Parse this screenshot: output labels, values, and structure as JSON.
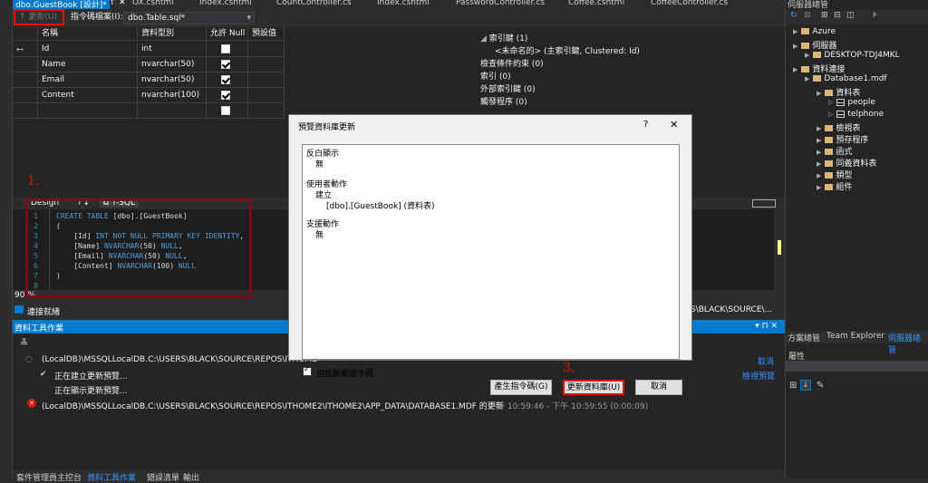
{
  "tabs": [
    "dbo.GuestBook [設計]*",
    "OX.cshtml",
    "Index.cshtml",
    "CountController.cs",
    "Index.cshtml",
    "PasswordController.cs",
    "Coffee.cshtml",
    "CoffeeController.cs"
  ],
  "tab_pin": "↑",
  "tab_close": "✕",
  "table_toolbar": {
    "update_label": "更新(U)",
    "script_label": "指令碼檔案(I):",
    "script_file": "dbo.Table.sql*"
  },
  "grid": {
    "headers": [
      "名稱",
      "資料型別",
      "允許 Null",
      "預設值"
    ],
    "rows": [
      {
        "key": true,
        "name": "Id",
        "type": "int",
        "nullable": false
      },
      {
        "key": false,
        "name": "Name",
        "type": "nvarchar(50)",
        "nullable": true
      },
      {
        "key": false,
        "name": "Email",
        "type": "nvarchar(50)",
        "nullable": true
      },
      {
        "key": false,
        "name": "Content",
        "type": "nvarchar(100)",
        "nullable": true
      },
      {
        "key": false,
        "name": "",
        "type": "",
        "nullable": false
      }
    ]
  },
  "props": {
    "indexes_header": "索引鍵 (1)",
    "pk_row": "<未命名的>   (主索引鍵, Clustered: Id)",
    "check_constraints": "檢查條件約束 (0)",
    "indexes": "索引 (0)",
    "foreign_keys": "外部索引鍵 (0)",
    "triggers": "觸發程序 (0)"
  },
  "sql_tabs": {
    "design": "Design",
    "swap": "↑↓",
    "tsql": "T-SQL"
  },
  "sql_lines": [
    {
      "n": "1",
      "text": "CREATE TABLE [dbo].[GuestBook]"
    },
    {
      "n": "2",
      "text": "("
    },
    {
      "n": "3",
      "text": "    [Id] INT NOT NULL PRIMARY KEY IDENTITY,"
    },
    {
      "n": "4",
      "text": "    [Name] NVARCHAR(50) NULL,"
    },
    {
      "n": "5",
      "text": "    [Email] NVARCHAR(50) NULL,"
    },
    {
      "n": "6",
      "text": "    [Content] NVARCHAR(100) NULL"
    },
    {
      "n": "7",
      "text": ")"
    },
    {
      "n": "8",
      "text": ""
    }
  ],
  "zoom": "90 %",
  "status_connected": "連接就緒",
  "status_path": "S\\BLACK\\SOURCE\\...",
  "data_tools": {
    "title": "資料工具作業",
    "pin": "▾ ⊓ ✕",
    "row1": "(LocalDB)\\MSSQLLocalDB.C:\\USERS\\BLACK\\SOURCE\\REPOS\\ITHOME",
    "row1_action": "取消",
    "row2": "正在建立更新預覽...",
    "row2_action": "檢視預覽",
    "row3": "正在顯示更新預覽...",
    "row4": "(LocalDB)\\MSSQLLocalDB.C:\\USERS\\BLACK\\SOURCE\\REPOS\\ITHOME2\\ITHOME2\\APP_DATA\\DATABASE1.MDF 的更新",
    "row4_time": "下午 10:59:46 - 下午 10:59:55 (0:00:09)"
  },
  "bottom_tabs": [
    "套件管理員主控台",
    "資料工具作業",
    "錯誤清單",
    "輸出"
  ],
  "server_explorer": {
    "title": "伺服器總管",
    "nodes": [
      {
        "label": "Azure",
        "depth": 0
      },
      {
        "label": "伺服器",
        "depth": 0
      },
      {
        "label": "DESKTOP-TDJ4MKL",
        "depth": 1
      },
      {
        "label": "資料連接",
        "depth": 0
      },
      {
        "label": "Database1.mdf",
        "depth": 1
      },
      {
        "label": "資料表",
        "depth": 2
      },
      {
        "label": "people",
        "depth": 3
      },
      {
        "label": "telphone",
        "depth": 3
      },
      {
        "label": "檢視表",
        "depth": 2
      },
      {
        "label": "預存程序",
        "depth": 2
      },
      {
        "label": "函式",
        "depth": 2
      },
      {
        "label": "同義資料表",
        "depth": 2
      },
      {
        "label": "類型",
        "depth": 2
      },
      {
        "label": "組件",
        "depth": 2
      }
    ],
    "bottom_tabs": [
      "方案總管",
      "Team Explorer",
      "伺服器總管"
    ],
    "properties_title": "屬性"
  },
  "dialog": {
    "title": "預覽資料庫更新",
    "help": "?",
    "close": "✕",
    "h1": "反白顯示",
    "v1": "無",
    "h2": "使用者動作",
    "v2a": "建立",
    "v2b": "[dbo].[GuestBook] (資料表)",
    "h3": "支援動作",
    "v3": "無",
    "checkbox_label": "包括異動指令碼",
    "gen_script": "產生指令碼(G)",
    "update_db": "更新資料庫(U)",
    "cancel": "取消"
  },
  "annotations": {
    "step1": "1.",
    "step3": "3."
  },
  "colors": {
    "accent": "#007acc",
    "highlight": "#e51400",
    "annotation_box": "#7a0e13"
  }
}
